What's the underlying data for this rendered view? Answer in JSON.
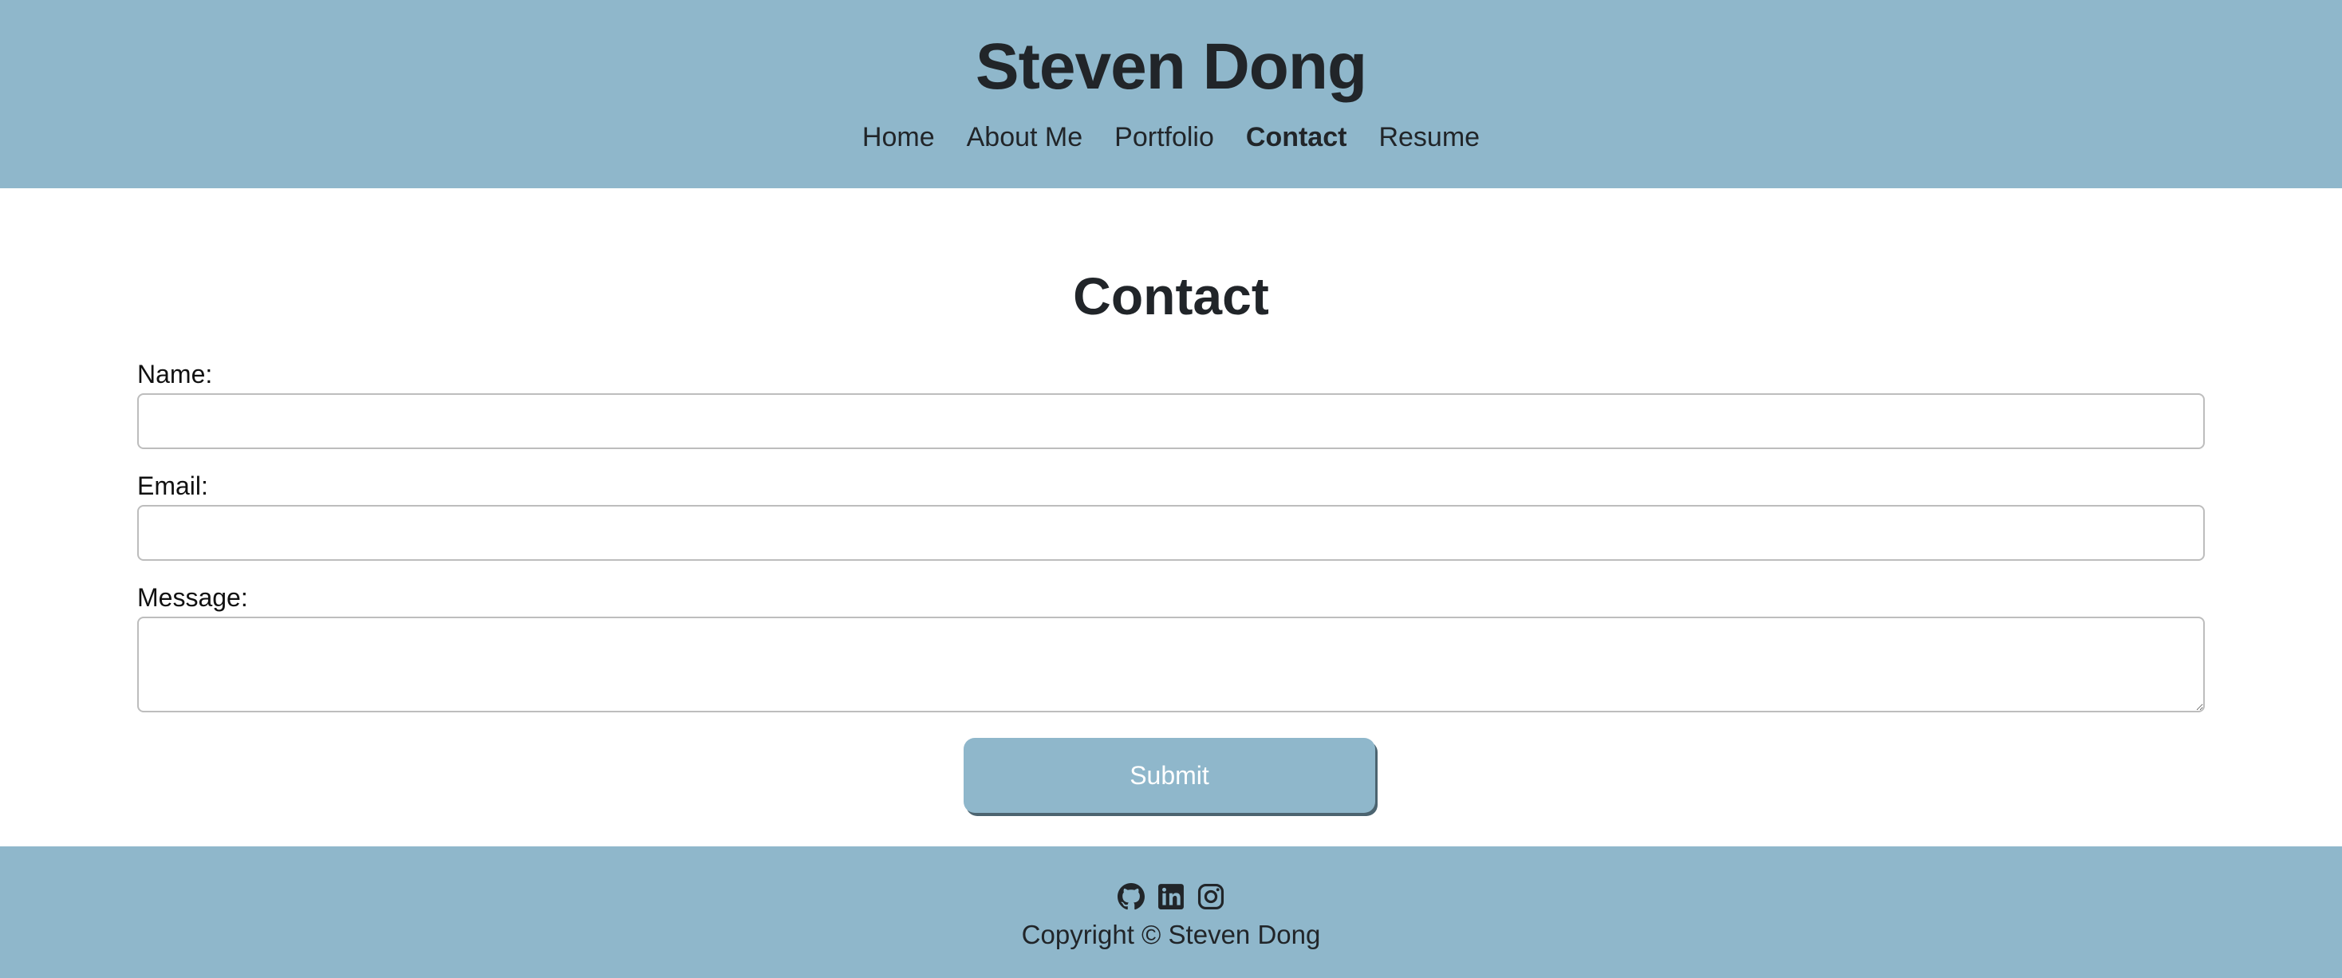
{
  "header": {
    "title": "Steven Dong",
    "nav": {
      "home": "Home",
      "about": "About Me",
      "portfolio": "Portfolio",
      "contact": "Contact",
      "resume": "Resume"
    },
    "active_item": "Contact"
  },
  "main": {
    "heading": "Contact",
    "form": {
      "name_label": "Name:",
      "name_value": "",
      "email_label": "Email:",
      "email_value": "",
      "message_label": "Message:",
      "message_value": "",
      "submit_label": "Submit"
    }
  },
  "footer": {
    "icons": [
      "github-icon",
      "linkedin-icon",
      "instagram-icon"
    ],
    "copyright": "Copyright © Steven Dong"
  },
  "colors": {
    "brand": "#8fb7cb",
    "text": "#212529",
    "button_text": "#ffffff"
  }
}
